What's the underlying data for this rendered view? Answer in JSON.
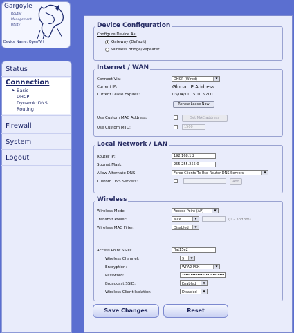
{
  "logo": {
    "title": "Gargoyle",
    "subtitle_lines": [
      "Router",
      "Management",
      "Utility"
    ],
    "device_name": "Device Name: OpenWrt"
  },
  "nav": {
    "status": "Status",
    "connection": "Connection",
    "connection_subitems": [
      "Basic",
      "DHCP",
      "Dynamic DNS",
      "Routing"
    ],
    "firewall": "Firewall",
    "system": "System",
    "logout": "Logout"
  },
  "device_config": {
    "legend": "Device Configuration",
    "configure_as": "Configure Device As:",
    "option_gateway": "Gateway (Default)",
    "option_bridge": "Wireless Bridge/Repeater",
    "selected": "gateway"
  },
  "wan": {
    "legend": "Internet / WAN",
    "connect_via_label": "Connect Via:",
    "connect_via_value": "DHCP (Wired)",
    "current_ip_label": "Current IP:",
    "current_ip_value": "Global IP Address",
    "lease_expires_label": "Current Lease Expires:",
    "lease_expires_value": "03/04/11 15:10 NZDT",
    "renew_button": "Renew Lease Now",
    "custom_mac_label": "Use Custom MAC Address:",
    "custom_mac_button": "Set MAC address",
    "custom_mtu_label": "Use Custom MTU:",
    "custom_mtu_value": "1500"
  },
  "lan": {
    "legend": "Local Network / LAN",
    "router_ip_label": "Router IP:",
    "router_ip_value": "192.168.1.2",
    "subnet_mask_label": "Subnet Mask:",
    "subnet_mask_value": "255.255.255.0",
    "alt_dns_label": "Allow Alternate DNS:",
    "alt_dns_value": "Force Clients To Use Router DNS Servers",
    "custom_dns_label": "Custom DNS Servers:",
    "add_button": "Add"
  },
  "wireless": {
    "legend": "Wireless",
    "mode_label": "Wireless Mode:",
    "mode_value": "Access Point (AP)",
    "tx_power_label": "Transmit Power:",
    "tx_power_value": "Max",
    "tx_power_unit": "(0 - 3odBm)",
    "mac_filter_label": "Wireless MAC Filter:",
    "mac_filter_value": "Disabled",
    "ssid_label": "Access Point SSID:",
    "ssid_value": "flat15e2",
    "channel_label": "Wireless Channel:",
    "channel_value": "9",
    "encryption_label": "Encryption:",
    "encryption_value": "WPA2 PSK",
    "password_label": "Password:",
    "password_value": "••••••••••••••••••••••••••",
    "broadcast_label": "Broadcast SSID:",
    "broadcast_value": "Enabled",
    "isolation_label": "Wireless Client Isolation:",
    "isolation_value": "Disabled"
  },
  "actions": {
    "save": "Save Changes",
    "reset": "Reset"
  },
  "colors": {
    "background": "#5b6fd0",
    "panel": "#e9ecfb",
    "accent_text": "#1b2466"
  }
}
